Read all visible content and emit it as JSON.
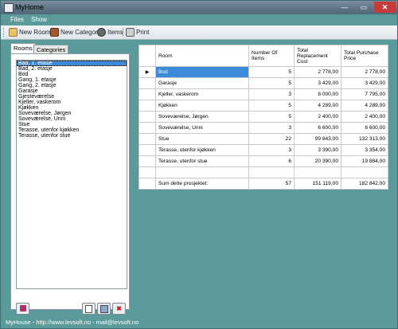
{
  "window": {
    "title": "MyHome",
    "min": "—",
    "max": "▭",
    "close": "✕"
  },
  "menu": [
    "Files",
    "Show"
  ],
  "toolbar": {
    "new_room": "New Room",
    "new_category": "New Category",
    "items": "Items",
    "print": "Print"
  },
  "tabs": {
    "rooms": "Rooms",
    "categories": "Categories"
  },
  "rooms_list": [
    "Bad, 1. etasje",
    "Bad, 2. etasje",
    "Bod",
    "Gang, 1. etasje",
    "Gang, 2. etasje",
    "Garasje",
    "Gjesteværelse",
    "Kjeller, vaskerom",
    "Kjøkken",
    "Soveværelse, Jørgen",
    "Soveværelse, Unni",
    "Stue",
    "Terasse, utenfor kjøkken",
    "Terasse, utenfor stue"
  ],
  "grid": {
    "headers": [
      "Room",
      "Number Of Items",
      "Total Replacement Cost",
      "Total Purchase Price"
    ],
    "rows": [
      [
        "Bod",
        "5",
        "2 778,00",
        "2 778,00"
      ],
      [
        "Garasje",
        "5",
        "3 429,00",
        "3 429,00"
      ],
      [
        "Kjeller, vaskerom",
        "3",
        "8 000,00",
        "7 795,00"
      ],
      [
        "Kjøkken",
        "5",
        "4 289,00",
        "4 289,00"
      ],
      [
        "Soveværelse, Jørgen",
        "5",
        "2 400,00",
        "2 400,00"
      ],
      [
        "Soveværelse, Unni",
        "3",
        "6 600,00",
        "6 600,00"
      ],
      [
        "Stue",
        "22",
        "99 843,00",
        "132 313,00"
      ],
      [
        "Terasse, utenfor kjøkken",
        "3",
        "3 390,00",
        "3 354,00"
      ],
      [
        "Terasse, utenfor stue",
        "6",
        "20 390,00",
        "19 884,00"
      ],
      [
        "",
        "",
        "",
        ""
      ],
      [
        "Sum dette prosjektet:",
        "57",
        "151 119,00",
        "182 842,00"
      ]
    ],
    "current_row_marker": "▶"
  },
  "status": "MyHouse - http://www.levsoft.no - mail@levsoft.no",
  "colors": {
    "background": "#5b9a9a",
    "selection": "#3b8bd9"
  }
}
